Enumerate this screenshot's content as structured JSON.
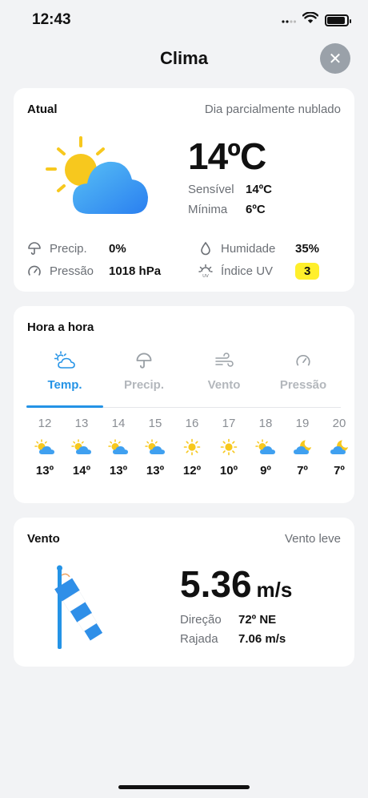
{
  "status": {
    "time": "12:43"
  },
  "header": {
    "title": "Clima",
    "close_icon": "close-icon"
  },
  "current": {
    "label": "Atual",
    "condition": "Dia parcialmente nublado",
    "icon": "partly-cloudy-icon",
    "temperature": "14ºC",
    "feels_like_label": "Sensível",
    "feels_like_value": "14ºC",
    "min_label": "Mínima",
    "min_value": "6ºC",
    "precip_label": "Precip.",
    "precip_value": "0%",
    "humidity_label": "Humidade",
    "humidity_value": "35%",
    "pressure_label": "Pressão",
    "pressure_value": "1018 hPa",
    "uv_label": "Índice UV",
    "uv_value": "3",
    "colors": {
      "uv_badge": "#ffef2b"
    }
  },
  "hourly": {
    "label": "Hora a hora",
    "tabs": [
      {
        "label": "Temp.",
        "icon": "partly-cloudy-icon",
        "active": true
      },
      {
        "label": "Precip.",
        "icon": "umbrella-icon",
        "active": false
      },
      {
        "label": "Vento",
        "icon": "wind-icon",
        "active": false
      },
      {
        "label": "Pressão",
        "icon": "gauge-icon",
        "active": false
      }
    ],
    "hours": [
      {
        "hour": "12",
        "icon": "partly-cloudy-icon",
        "temp": "13º"
      },
      {
        "hour": "13",
        "icon": "partly-cloudy-icon",
        "temp": "14º"
      },
      {
        "hour": "14",
        "icon": "partly-cloudy-icon",
        "temp": "13º"
      },
      {
        "hour": "15",
        "icon": "partly-cloudy-icon",
        "temp": "13º"
      },
      {
        "hour": "16",
        "icon": "sun-icon",
        "temp": "12º"
      },
      {
        "hour": "17",
        "icon": "sun-icon",
        "temp": "10º"
      },
      {
        "hour": "18",
        "icon": "partly-cloudy-icon",
        "temp": "9º"
      },
      {
        "hour": "19",
        "icon": "cloudy-night-icon",
        "temp": "7º"
      },
      {
        "hour": "20",
        "icon": "cloudy-night-icon",
        "temp": "7º"
      }
    ],
    "colors": {
      "accent": "#2493e6"
    }
  },
  "wind": {
    "label": "Vento",
    "condition": "Vento leve",
    "icon": "windsock-icon",
    "speed": "5.36",
    "unit": "m/s",
    "direction_label": "Direção",
    "direction_value": "72º NE",
    "gust_label": "Rajada",
    "gust_value": "7.06 m/s"
  }
}
